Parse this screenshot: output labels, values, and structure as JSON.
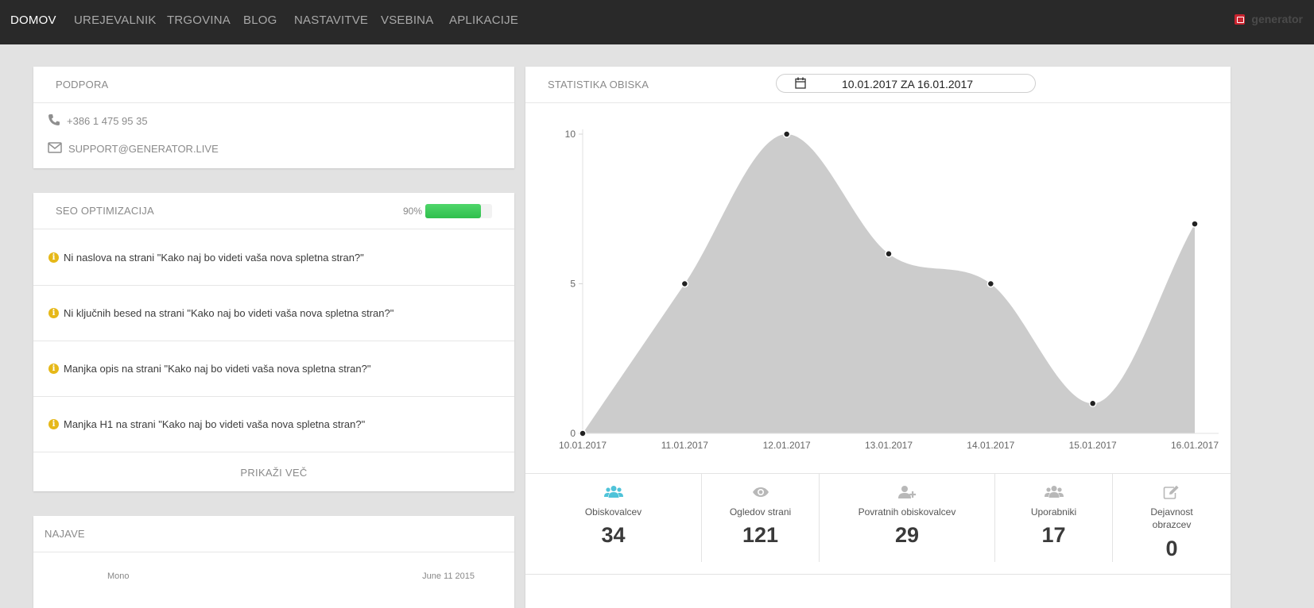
{
  "nav": {
    "items": [
      "DOMOV",
      "UREJEVALNIK",
      "TRGOVINA",
      "BLOG",
      "NASTAVITVE",
      "VSEBINA",
      "APLIKACIJE"
    ],
    "brand": "generator"
  },
  "support": {
    "title": "PODPORA",
    "phone": "+386 1 475 95 35",
    "email": "SUPPORT@GENERATOR.LIVE"
  },
  "seo": {
    "title": "SEO OPTIMIZACIJA",
    "percent_label": "90%",
    "progress": 0.9,
    "items": [
      "Ni naslova na strani \"Kako naj bo videti vaša nova spletna stran?\"",
      "Ni ključnih besed na strani \"Kako naj bo videti vaša nova spletna stran?\"",
      "Manjka opis na strani \"Kako naj bo videti vaša nova spletna stran?\"",
      "Manjka H1 na strani \"Kako naj bo videti vaša nova spletna stran?\""
    ],
    "show_more": "PRIKAŽI VEČ"
  },
  "news": {
    "title": "NAJAVE",
    "partial_left": "Mono",
    "partial_right": "June 11 2015"
  },
  "stats": {
    "title": "STATISTIKA OBISKA",
    "date_range": "10.01.2017 ZA 16.01.2017",
    "cards": [
      {
        "icon": "users-icon",
        "label": "Obiskovalcev",
        "value": "34",
        "accent": "#4fc3d9"
      },
      {
        "icon": "eye-icon",
        "label": "Ogledov strani",
        "value": "121",
        "accent": "#b5b5b5"
      },
      {
        "icon": "user-plus-icon",
        "label": "Povratnih obiskovalcev",
        "value": "29",
        "accent": "#b5b5b5"
      },
      {
        "icon": "users-icon",
        "label": "Uporabniki",
        "value": "17",
        "accent": "#b5b5b5"
      },
      {
        "icon": "edit-icon",
        "label": "Dejavnost obrazcev",
        "value": "0",
        "accent": "#b5b5b5"
      }
    ]
  },
  "chart_data": {
    "type": "area",
    "categories": [
      "10.01.2017",
      "11.01.2017",
      "12.01.2017",
      "13.01.2017",
      "14.01.2017",
      "15.01.2017",
      "16.01.2017"
    ],
    "values": [
      0,
      5,
      10,
      6,
      5,
      1,
      7
    ],
    "ylim": [
      0,
      10
    ],
    "yticks": [
      "0",
      "5",
      "10"
    ],
    "fill_color": "#cccccc",
    "grid": false
  }
}
